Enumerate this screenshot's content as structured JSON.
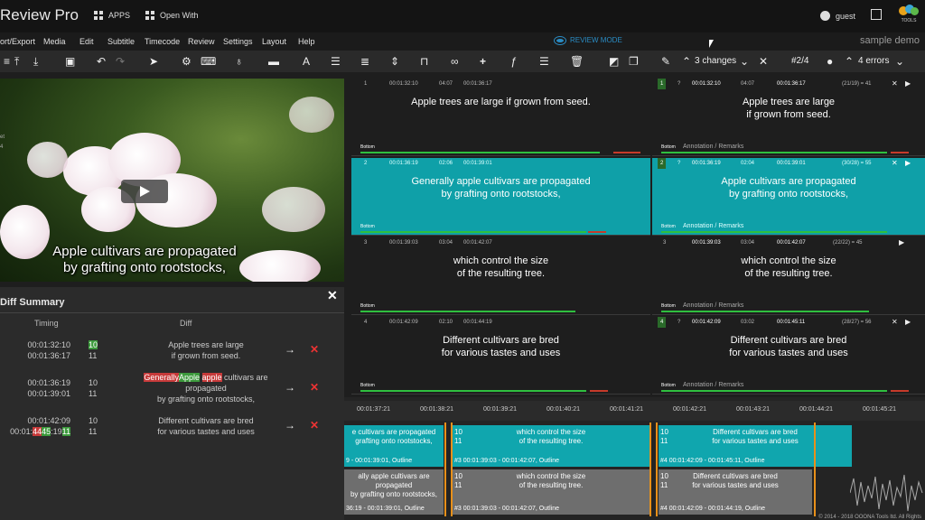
{
  "app": {
    "title": "Review Pro",
    "apps_label": "APPS",
    "open_with_label": "Open With",
    "user": "guest",
    "logo_text": "TOOLS"
  },
  "menu": {
    "items": [
      "ort/Export",
      "Media",
      "Edit",
      "Subtitle",
      "Timecode",
      "Review",
      "Settings",
      "Layout",
      "Help"
    ],
    "review_mode": "REVIEW MODE",
    "sample_demo": "sample demo"
  },
  "toolbar": {
    "changes_label": "3 changes",
    "position": "#2/4",
    "errors_label": "4 errors"
  },
  "video": {
    "subtitle_line1": "Apple cultivars are propagated",
    "subtitle_line2": "by grafting onto rootstocks,",
    "side_text_1": "et",
    "side_text_2": "4"
  },
  "diff": {
    "title": "Diff Summary",
    "header_timing": "Timing",
    "header_diff": "Diff",
    "rows": [
      {
        "t1": "00:01:32:10",
        "t2": "00:01:36:17",
        "n1": "10",
        "n2": "11",
        "text1": "Apple trees are large",
        "text2": "if grown from seed."
      },
      {
        "t1": "00:01:36:19",
        "t2": "00:01:39:01",
        "n1": "10",
        "n2": "11",
        "del1": "Generally",
        "ins1": "Apple",
        "del2": "apple",
        "rest1": " cultivars are",
        "text2": "propagated",
        "text3": "by grafting onto rootstocks,"
      },
      {
        "t1": "00:01:42:09",
        "t2a": "00:01:",
        "t2del": "44",
        "t2ins": "45",
        "t2b": ":19",
        "t2ins2": "11",
        "n1": "10",
        "n2": "11",
        "text1": "Different cultivars are bred",
        "text2": "for various tastes and uses"
      }
    ]
  },
  "left_grid": [
    {
      "num": "1",
      "in": "00:01:32:10",
      "dur": "04:07",
      "out": "00:01:36:17",
      "line1": "Apple trees are large if grown from seed.",
      "line2": "",
      "pos": "Bottom"
    },
    {
      "num": "2",
      "in": "00:01:36:19",
      "dur": "02:06",
      "out": "00:01:39:01",
      "line1": "Generally apple cultivars are propagated",
      "line2": "by grafting onto rootstocks,",
      "pos": "Bottom"
    },
    {
      "num": "3",
      "in": "00:01:39:03",
      "dur": "03:04",
      "out": "00:01:42:07",
      "line1": "which control the size",
      "line2": "of the resulting tree.",
      "pos": "Bottom"
    },
    {
      "num": "4",
      "in": "00:01:42:09",
      "dur": "02:10",
      "out": "00:01:44:19",
      "line1": "Different cultivars are bred",
      "line2": "for various tastes and uses",
      "pos": "Bottom"
    }
  ],
  "right_grid": [
    {
      "num": "1",
      "q": "?",
      "in": "00:01:32:10",
      "dur": "04:07",
      "out": "00:01:36:17",
      "ratio": "(21/19) = 41",
      "line1": "Apple trees are large",
      "line2": "if grown from seed.",
      "pos": "Bottom",
      "annotation": "Annotation",
      "remarks": "Remarks"
    },
    {
      "num": "2",
      "q": "?",
      "in": "00:01:36:19",
      "dur": "02:04",
      "out": "00:01:39:01",
      "ratio": "(30/28) = 55",
      "line1": "Apple cultivars are propagated",
      "line2": "by grafting onto rootstocks,",
      "pos": "Bottom",
      "annotation": "Annotation",
      "remarks": "Remarks"
    },
    {
      "num": "3",
      "q": "?",
      "in": "00:01:39:03",
      "dur": "03:04",
      "out": "00:01:42:07",
      "ratio": "(22/22) = 45",
      "line1": "which control the size",
      "line2": "of the resulting tree.",
      "pos": "Bottom",
      "annotation": "Annotation",
      "remarks": "Remarks"
    },
    {
      "num": "4",
      "q": "?",
      "in": "00:01:42:09",
      "dur": "03:02",
      "out": "00:01:45:11",
      "ratio": "(28/27) = 56",
      "line1": "Different cultivars are bred",
      "line2": "for various tastes and uses",
      "pos": "Bottom",
      "annotation": "Annotation",
      "remarks": "Remarks"
    }
  ],
  "timeline": {
    "ticks": [
      "00:01:37:21",
      "00:01:38:21",
      "00:01:39:21",
      "00:01:40:21",
      "00:01:41:21",
      "00:01:42:21",
      "00:01:43:21",
      "00:01:44:21",
      "00:01:45:21"
    ],
    "top_blocks": [
      {
        "num": "",
        "line1": "e cultivars are propagated",
        "line2": "grafting onto rootstocks,",
        "foot": "9 - 00:01:39:01, Outline"
      },
      {
        "num": "10\n11",
        "line1": "which control the size",
        "line2": "of the resulting tree.",
        "foot": "#3 00:01:39:03 - 00:01:42:07, Outline"
      },
      {
        "num": "10\n11",
        "line1": "Different cultivars are bred",
        "line2": "for various tastes and uses",
        "foot": "#4 00:01:42:09 - 00:01:45:11, Outline"
      }
    ],
    "bottom_blocks": [
      {
        "num": "",
        "line1": "ally apple cultivars are",
        "line2": "propagated",
        "line3": "by grafting onto rootstocks,",
        "foot": "36:19 - 00:01:39:01, Outline"
      },
      {
        "num": "10\n11",
        "line1": "which control the size",
        "line2": "of the resulting tree.",
        "foot": "#3 00:01:39:03 - 00:01:42:07, Outline"
      },
      {
        "num": "10\n11",
        "line1": "Different cultivars are bred",
        "line2": "for various tastes and uses",
        "foot": "#4 00:01:42:09 - 00:01:44:19, Outline"
      }
    ],
    "copyright": "© 2014 - 2018 OOONA Tools ltd. All Rights"
  },
  "colors": {
    "accent": "#0fa0a8",
    "review_mode": "#2a8cc4",
    "insert": "#3c9a3c",
    "delete": "#c73a3a",
    "marker": "#e8901a"
  }
}
